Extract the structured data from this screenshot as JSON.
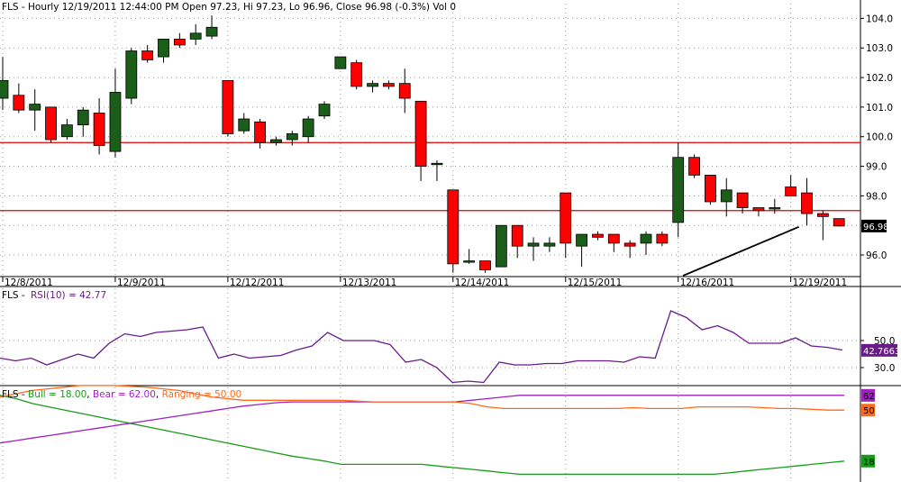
{
  "chart_data": [
    {
      "type": "candlestick",
      "title": "FLS - Hourly 12/19/2011 12:44:00 PM Open 97.23, Hi 97.23, Lo 96.96, Close 96.98 (-0.3%) Vol 0",
      "ylim": [
        95.3,
        104.5
      ],
      "y_ticks": [
        "104.0",
        "103.0",
        "102.0",
        "101.0",
        "100.0",
        "99.0",
        "98.0",
        "97.0",
        "96.0"
      ],
      "date_labels": [
        "12/8/2011",
        "12/9/2011",
        "12/12/2011",
        "12/13/2011",
        "12/14/2011",
        "12/15/2011",
        "12/16/2011",
        "12/19/2011"
      ],
      "date_label_index": [
        0,
        7,
        14,
        21,
        28,
        35,
        42,
        49
      ],
      "last_price_label": "96.98",
      "last_price": 96.98,
      "candles": [
        {
          "o": 101.3,
          "h": 102.7,
          "l": 100.9,
          "c": 101.9
        },
        {
          "o": 101.4,
          "h": 101.8,
          "l": 100.8,
          "c": 100.9
        },
        {
          "o": 100.9,
          "h": 101.6,
          "l": 100.2,
          "c": 101.1
        },
        {
          "o": 101.0,
          "h": 101.0,
          "l": 99.8,
          "c": 99.9
        },
        {
          "o": 100.0,
          "h": 100.6,
          "l": 99.9,
          "c": 100.4
        },
        {
          "o": 100.4,
          "h": 101.0,
          "l": 100.0,
          "c": 100.9
        },
        {
          "o": 100.8,
          "h": 101.3,
          "l": 99.4,
          "c": 99.7
        },
        {
          "o": 99.5,
          "h": 102.3,
          "l": 99.3,
          "c": 101.5
        },
        {
          "o": 101.3,
          "h": 103.0,
          "l": 101.1,
          "c": 102.9
        },
        {
          "o": 102.9,
          "h": 103.1,
          "l": 102.5,
          "c": 102.6
        },
        {
          "o": 102.7,
          "h": 103.3,
          "l": 102.5,
          "c": 103.3
        },
        {
          "o": 103.3,
          "h": 103.5,
          "l": 103.0,
          "c": 103.1
        },
        {
          "o": 103.3,
          "h": 103.8,
          "l": 103.1,
          "c": 103.5
        },
        {
          "o": 103.4,
          "h": 104.1,
          "l": 103.3,
          "c": 103.7
        },
        {
          "o": 101.9,
          "h": 101.9,
          "l": 100.0,
          "c": 100.1
        },
        {
          "o": 100.2,
          "h": 100.8,
          "l": 100.1,
          "c": 100.6
        },
        {
          "o": 100.5,
          "h": 100.6,
          "l": 99.6,
          "c": 99.8
        },
        {
          "o": 99.8,
          "h": 100.0,
          "l": 99.7,
          "c": 99.9
        },
        {
          "o": 99.9,
          "h": 100.2,
          "l": 99.7,
          "c": 100.1
        },
        {
          "o": 100.0,
          "h": 100.7,
          "l": 99.8,
          "c": 100.6
        },
        {
          "o": 100.7,
          "h": 101.2,
          "l": 100.6,
          "c": 101.1
        },
        {
          "o": 102.3,
          "h": 102.7,
          "l": 102.3,
          "c": 102.7
        },
        {
          "o": 102.5,
          "h": 102.6,
          "l": 101.6,
          "c": 101.7
        },
        {
          "o": 101.7,
          "h": 101.9,
          "l": 101.5,
          "c": 101.8
        },
        {
          "o": 101.8,
          "h": 101.9,
          "l": 101.6,
          "c": 101.7
        },
        {
          "o": 101.8,
          "h": 102.3,
          "l": 100.8,
          "c": 101.3
        },
        {
          "o": 101.2,
          "h": 101.2,
          "l": 98.5,
          "c": 99.0
        },
        {
          "o": 99.1,
          "h": 99.2,
          "l": 98.5,
          "c": 99.1
        },
        {
          "o": 98.2,
          "h": 98.2,
          "l": 95.4,
          "c": 95.7
        },
        {
          "o": 95.8,
          "h": 96.2,
          "l": 95.7,
          "c": 95.8
        },
        {
          "o": 95.8,
          "h": 95.8,
          "l": 95.4,
          "c": 95.5
        },
        {
          "o": 95.6,
          "h": 97.0,
          "l": 95.6,
          "c": 97.0
        },
        {
          "o": 97.0,
          "h": 97.0,
          "l": 95.9,
          "c": 96.3
        },
        {
          "o": 96.3,
          "h": 96.6,
          "l": 95.8,
          "c": 96.4
        },
        {
          "o": 96.3,
          "h": 96.6,
          "l": 96.1,
          "c": 96.4
        },
        {
          "o": 98.1,
          "h": 98.1,
          "l": 95.9,
          "c": 96.4
        },
        {
          "o": 96.3,
          "h": 96.7,
          "l": 95.6,
          "c": 96.7
        },
        {
          "o": 96.7,
          "h": 96.8,
          "l": 96.5,
          "c": 96.6
        },
        {
          "o": 96.7,
          "h": 96.7,
          "l": 96.1,
          "c": 96.4
        },
        {
          "o": 96.4,
          "h": 96.5,
          "l": 95.9,
          "c": 96.3
        },
        {
          "o": 96.4,
          "h": 96.8,
          "l": 96.0,
          "c": 96.7
        },
        {
          "o": 96.7,
          "h": 96.8,
          "l": 96.3,
          "c": 96.4
        },
        {
          "o": 97.1,
          "h": 99.8,
          "l": 96.6,
          "c": 99.3
        },
        {
          "o": 99.3,
          "h": 99.4,
          "l": 98.6,
          "c": 98.7
        },
        {
          "o": 98.7,
          "h": 98.7,
          "l": 97.7,
          "c": 97.8
        },
        {
          "o": 97.8,
          "h": 98.6,
          "l": 97.3,
          "c": 98.2
        },
        {
          "o": 98.1,
          "h": 98.1,
          "l": 97.4,
          "c": 97.6
        },
        {
          "o": 97.6,
          "h": 97.6,
          "l": 97.3,
          "c": 97.5
        },
        {
          "o": 97.6,
          "h": 97.9,
          "l": 97.4,
          "c": 97.6
        },
        {
          "o": 98.3,
          "h": 98.7,
          "l": 98.0,
          "c": 98.0
        },
        {
          "o": 98.1,
          "h": 98.6,
          "l": 97.0,
          "c": 97.4
        },
        {
          "o": 97.4,
          "h": 97.5,
          "l": 96.5,
          "c": 97.3
        },
        {
          "o": 97.23,
          "h": 97.23,
          "l": 96.96,
          "c": 96.98
        }
      ],
      "horizontal_lines": [
        99.8,
        97.5
      ],
      "trendline": [
        {
          "i": 42.3,
          "p": 95.3
        },
        {
          "i": 49.5,
          "p": 96.95
        }
      ],
      "colors": {
        "up": "#1a5e1a",
        "down": "#ff0000",
        "wick": "#000000",
        "hline": "#dd0000",
        "trend": "#000000"
      }
    },
    {
      "type": "line",
      "legend_prefix": "FLS - ",
      "title": "RSI(10) = 42.77",
      "ylim": [
        18,
        80
      ],
      "y_ticks": [
        "50.0",
        "30.0"
      ],
      "last_label": "42.7663",
      "last_value": 42.77,
      "color": "#6a1a8a",
      "values": [
        37,
        35,
        37,
        32,
        36,
        40,
        37,
        48,
        55,
        53,
        56,
        57,
        58,
        60,
        37,
        40,
        37,
        38,
        39,
        43,
        46,
        56,
        50,
        50,
        50,
        47,
        34,
        36,
        30,
        19,
        20,
        19,
        34,
        32,
        32,
        33,
        33,
        35,
        35,
        35,
        34,
        38,
        37,
        72,
        67,
        58,
        61,
        56,
        48,
        48,
        48,
        52,
        46,
        45,
        43
      ]
    },
    {
      "type": "line",
      "legend_prefix": "FLS - ",
      "series": [
        {
          "name": "Bull = 18.00",
          "color": "#1a9a1a",
          "last_label": "18",
          "values": [
            98,
            94,
            88,
            84,
            80,
            76,
            72,
            68,
            64,
            60,
            56,
            52,
            48,
            44,
            40,
            36,
            32,
            28,
            24,
            21,
            18,
            14,
            14,
            14,
            14,
            14,
            14,
            12,
            10,
            8,
            6,
            4,
            2,
            2,
            2,
            2,
            2,
            2,
            2,
            2,
            2,
            2,
            2,
            2,
            2,
            4,
            6,
            8,
            10,
            12,
            14,
            16,
            18
          ]
        },
        {
          "name": "Bear = 62.00",
          "color": "#a020c0",
          "last_label": "62",
          "values": [
            40,
            43,
            46,
            49,
            52,
            55,
            58,
            61,
            64,
            67,
            70,
            73,
            76,
            79,
            82,
            85,
            87,
            89,
            90,
            90,
            90,
            90,
            90,
            90,
            90,
            90,
            90,
            90,
            90,
            92,
            94,
            96,
            98,
            98,
            98,
            98,
            98,
            98,
            98,
            98,
            98,
            98,
            98,
            98,
            98,
            98,
            98,
            98,
            98,
            98,
            98,
            98,
            98
          ]
        },
        {
          "name": "Ranging = 50.00",
          "color": "#ff6a1a",
          "last_label": "50",
          "values": [
            96,
            100,
            104,
            106,
            108,
            110,
            110,
            110,
            109,
            108,
            106,
            104,
            100,
            96,
            94,
            92,
            92,
            92,
            92,
            92,
            92,
            92,
            91,
            90,
            90,
            90,
            90,
            90,
            90,
            88,
            84,
            82,
            82,
            82,
            82,
            82,
            82,
            82,
            82,
            83,
            82,
            82,
            82,
            84,
            84,
            84,
            84,
            83,
            82,
            82,
            81,
            80,
            80
          ]
        }
      ],
      "ylim": [
        0,
        100
      ]
    }
  ]
}
